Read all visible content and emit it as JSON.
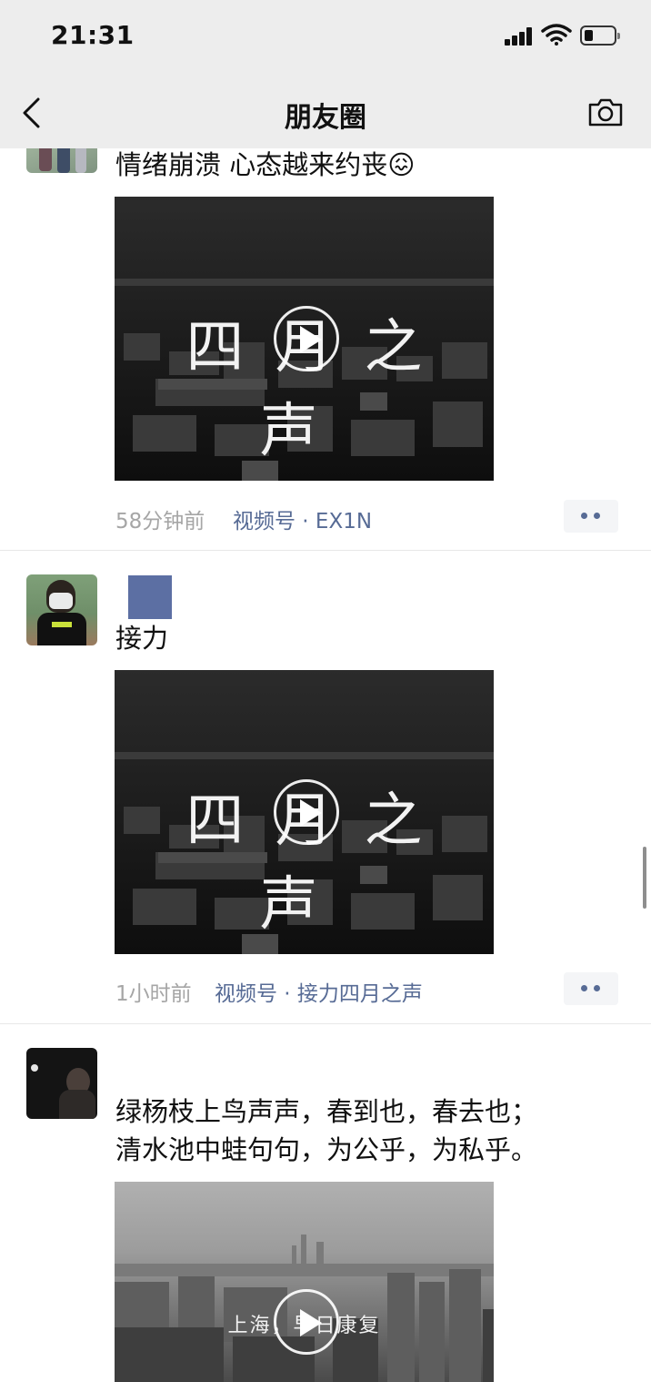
{
  "status_bar": {
    "time": "21:31"
  },
  "header": {
    "title": "朋友圈",
    "back_icon": "chevron-left-icon",
    "camera_icon": "camera-icon"
  },
  "posts": [
    {
      "text": "情绪崩溃 心态越来约丧😖",
      "video_title": "四月之声",
      "time": "58分钟前",
      "source": "视频号 · EX1N"
    },
    {
      "text": "接力",
      "video_title": "四月之声",
      "time": "1小时前",
      "source": "视频号 · 接力四月之声"
    },
    {
      "text_line1": "绿杨枝上鸟声声，春到也，春去也；",
      "text_line2": "清水池中蛙句句，为公乎，为私乎。",
      "video_caption": "上海，早日康复"
    }
  ],
  "colors": {
    "link": "#576b95",
    "meta_gray": "#a6a6a6",
    "header_bg": "#ededed",
    "name_placeholder": "#5c6fa3"
  }
}
